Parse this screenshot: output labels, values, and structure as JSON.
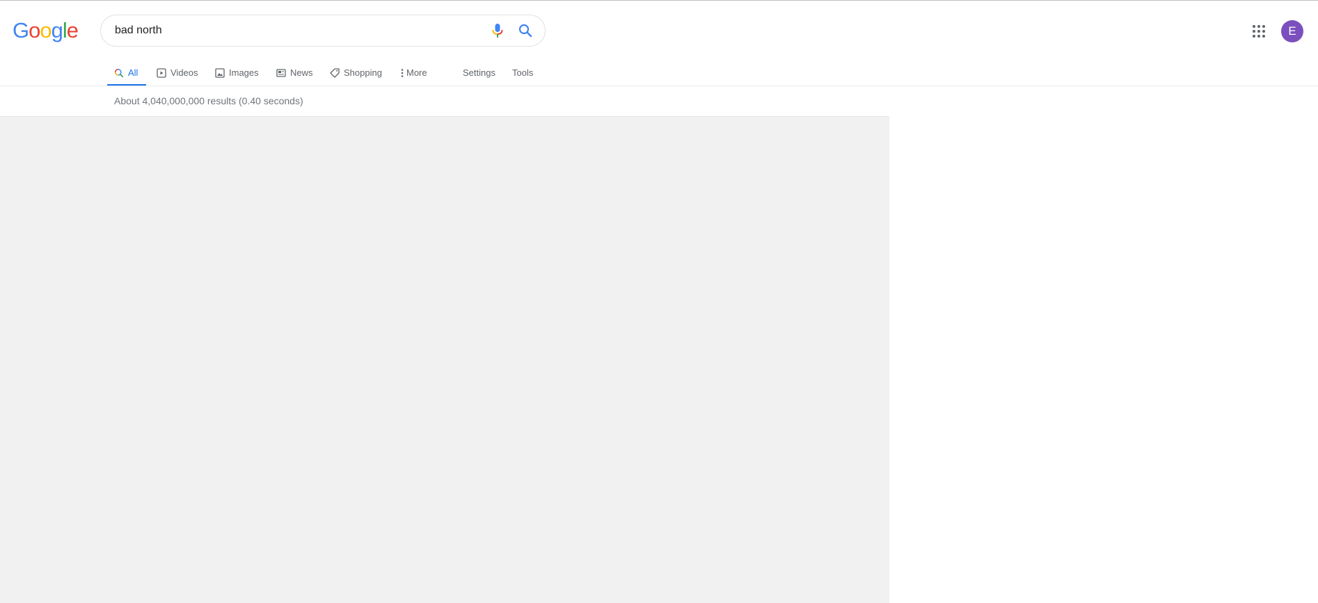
{
  "logo": {
    "letters": [
      "G",
      "o",
      "o",
      "g",
      "l",
      "e"
    ],
    "colors": [
      "#4285f4",
      "#ea4335",
      "#fbbc05",
      "#4285f4",
      "#34a853",
      "#ea4335"
    ]
  },
  "search": {
    "query": "bad north",
    "mic_icon": "microphone-icon",
    "search_icon": "search-icon"
  },
  "header_right": {
    "apps_icon": "apps-grid-icon",
    "avatar_letter": "E",
    "avatar_color": "#7b4fbd"
  },
  "tabs": [
    {
      "label": "All",
      "icon": "search-icon",
      "active": true
    },
    {
      "label": "Videos",
      "icon": "play-icon",
      "active": false
    },
    {
      "label": "Images",
      "icon": "image-icon",
      "active": false
    },
    {
      "label": "News",
      "icon": "news-icon",
      "active": false
    },
    {
      "label": "Shopping",
      "icon": "tag-icon",
      "active": false
    },
    {
      "label": "More",
      "icon": "more-vert-icon",
      "active": false
    }
  ],
  "tools": [
    {
      "label": "Settings"
    },
    {
      "label": "Tools"
    }
  ],
  "results": {
    "stats": "About 4,040,000,000 results (0.40 seconds)"
  },
  "colors": {
    "accent": "#1a73e8",
    "placeholder_bg": "#f1f1f1"
  }
}
